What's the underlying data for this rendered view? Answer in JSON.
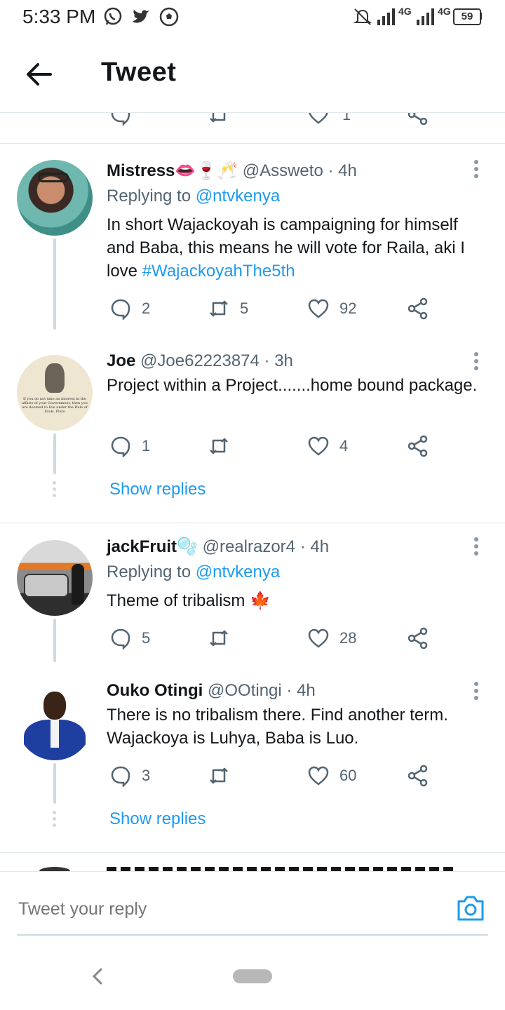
{
  "status_bar": {
    "time": "5:33 PM",
    "network1": "4G",
    "network2": "4G",
    "battery": "59"
  },
  "header": {
    "title": "Tweet"
  },
  "prev_actions": {
    "likes": "1"
  },
  "tweets": [
    {
      "name": "Mistress",
      "name_emoji": "👄🍷🥂",
      "handle": "@Assweto",
      "time": "· 4h",
      "replying_prefix": "Replying to",
      "replying_to": "@ntvkenya",
      "text": "In short Wajackoyah is campaigning for himself and Baba, this means he will vote for Raila, aki I love",
      "hashtag": "#WajackoyahThe5th",
      "replies": "2",
      "retweets": "5",
      "likes": "92"
    },
    {
      "name": "Joe",
      "handle": "@Joe62223874",
      "time": "· 3h",
      "text": "Project  within  a Project.......home bound package.",
      "replies": "1",
      "retweets": "",
      "likes": "4",
      "avatar_text": "If you do not take an interest in the affairs of your Government, then you are doomed to live under the Rule of Fools. Plato"
    },
    {
      "name": "jackFruit",
      "name_emoji": "🫧",
      "handle": "@realrazor4",
      "time": "· 4h",
      "replying_prefix": "Replying to",
      "replying_to": "@ntvkenya",
      "text": "Theme of tribalism",
      "text_emoji": "🍁",
      "replies": "5",
      "retweets": "",
      "likes": "28"
    },
    {
      "name": "Ouko Otingi",
      "handle": "@OOtingi",
      "time": "· 4h",
      "text": "There is no tribalism there. Find another term. Wajackoya is Luhya, Baba is Luo.",
      "replies": "3",
      "retweets": "",
      "likes": "60"
    }
  ],
  "show_replies_label": "Show replies",
  "reply_bar": {
    "placeholder": "Tweet your reply"
  },
  "icons": [
    "whatsapp-icon",
    "twitter-icon",
    "soccer-ball-icon",
    "bell-off-icon",
    "signal-icon",
    "battery-icon",
    "back-arrow-icon",
    "reply-icon",
    "retweet-icon",
    "like-icon",
    "share-icon",
    "more-icon",
    "camera-icon",
    "nav-back-icon"
  ],
  "colors": {
    "link": "#1d9bf0",
    "secondary": "#536471",
    "text": "#14171a"
  }
}
